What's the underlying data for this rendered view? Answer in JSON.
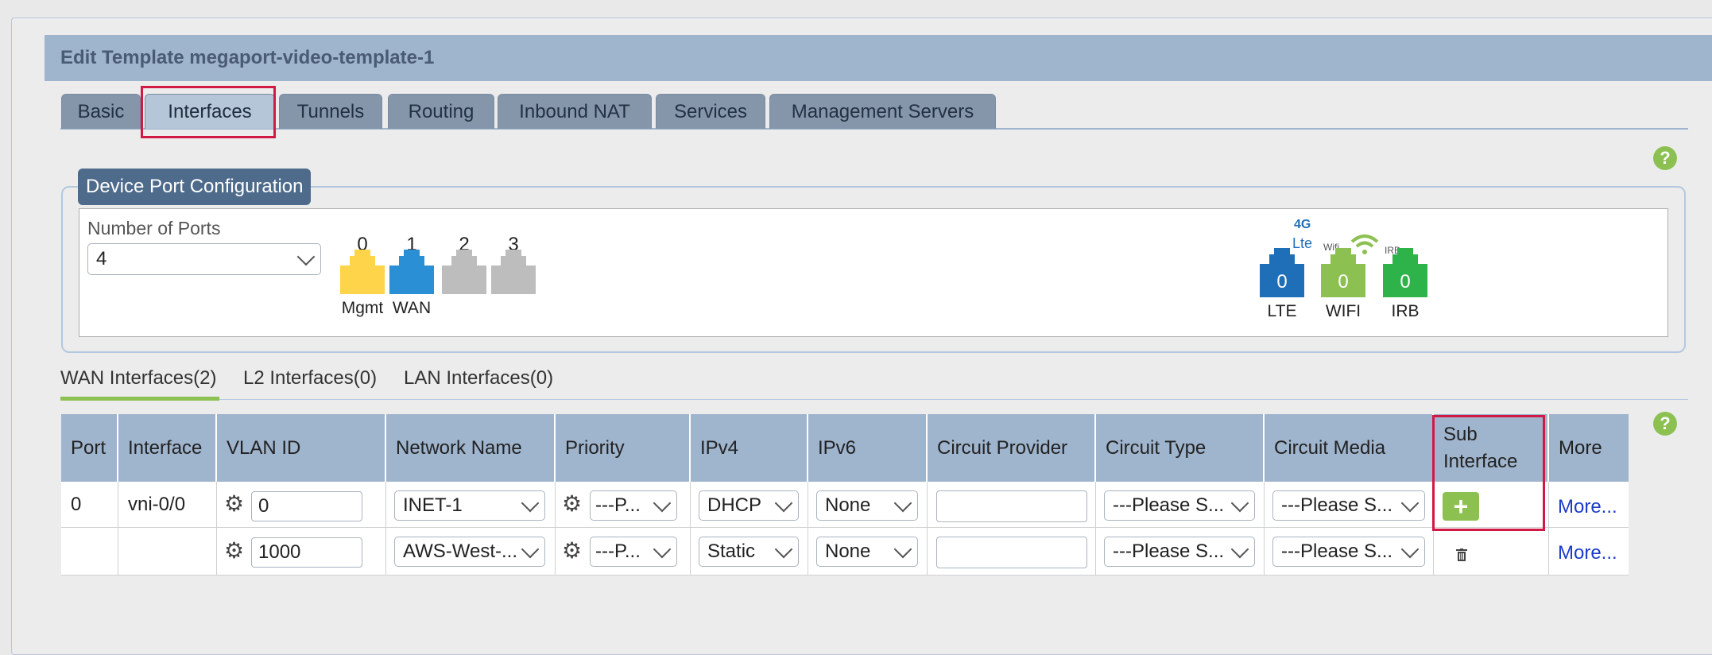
{
  "title": "Edit Template megaport-video-template-1",
  "tabs": [
    "Basic",
    "Interfaces",
    "Tunnels",
    "Routing",
    "Inbound NAT",
    "Services",
    "Management Servers"
  ],
  "help_icon": "?",
  "device_port_config": {
    "title": "Device Port Configuration",
    "num_ports_label": "Number of Ports",
    "num_ports_value": "4",
    "ports": [
      {
        "num": "0",
        "label": "Mgmt",
        "color": "#fdd44a"
      },
      {
        "num": "1",
        "label": "WAN",
        "color": "#2b8fd6"
      },
      {
        "num": "2",
        "label": "",
        "color": "#bdbdbd"
      },
      {
        "num": "3",
        "label": "",
        "color": "#bdbdbd"
      }
    ],
    "extra_ports": [
      {
        "label": "LTE",
        "value": "0",
        "color": "#1f6fb8",
        "icon_text": "4G",
        "icon_sub": "Lte"
      },
      {
        "label": "WIFI",
        "value": "0",
        "color": "#8cc152",
        "icon_text": "Wifi"
      },
      {
        "label": "IRB",
        "value": "0",
        "color": "#2eb34a",
        "icon_text": "IRB"
      }
    ]
  },
  "subtabs": [
    "WAN Interfaces(2)",
    "L2 Interfaces(0)",
    "LAN Interfaces(0)"
  ],
  "table": {
    "headers": [
      "Port",
      "Interface",
      "VLAN ID",
      "Network Name",
      "Priority",
      "IPv4",
      "IPv6",
      "Circuit Provider",
      "Circuit Type",
      "Circuit Media",
      "Sub Interface",
      "More"
    ],
    "rows": [
      {
        "port": "0",
        "interface": "vni-0/0",
        "vlan": "0",
        "network": "INET-1",
        "priority": "---P...",
        "ipv4": "DHCP",
        "ipv6": "None",
        "provider": "",
        "type": "---Please S...",
        "media": "---Please S...",
        "sub": "+",
        "more": "More..."
      },
      {
        "port": "",
        "interface": "",
        "vlan": "1000",
        "network": "AWS-West-...",
        "priority": "---P...",
        "ipv4": "Static",
        "ipv6": "None",
        "provider": "",
        "type": "---Please S...",
        "media": "---Please S...",
        "sub": "trash",
        "more": "More..."
      }
    ]
  }
}
